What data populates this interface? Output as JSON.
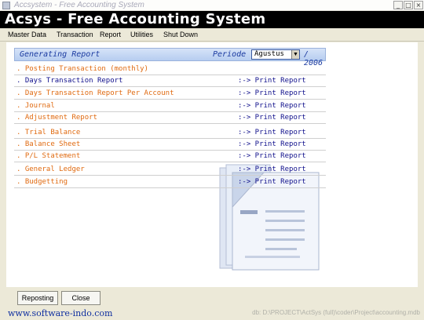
{
  "window": {
    "title": "Accsystem - Free Accounting System",
    "banner": "Acsys - Free Accounting System"
  },
  "menu": [
    "Master Data",
    "Transaction",
    "Report",
    "Utilities",
    "Shut Down"
  ],
  "report_header": {
    "title": "Generating Report",
    "periode_label": "Periode :",
    "month": "Agustus",
    "year": "/ 2006"
  },
  "reports": [
    {
      "label": ". Posting Transaction (monthly)",
      "action": ""
    },
    {
      "label": ". Days Transaction Report",
      "action": ":-> Print Report"
    },
    {
      "label": ". Days Transaction Report Per Account",
      "action": ":-> Print Report"
    },
    {
      "label": ". Journal",
      "action": ":-> Print Report"
    },
    {
      "label": ". Adjustment Report",
      "action": ":-> Print Report"
    },
    {
      "label": ". Trial Balance",
      "action": ":-> Print Report"
    },
    {
      "label": ". Balance Sheet",
      "action": ":-> Print Report"
    },
    {
      "label": ". P/L Statement",
      "action": ":-> Print Report"
    },
    {
      "label": ". General Ledger",
      "action": ":-> Print Report"
    },
    {
      "label": ". Budgetting",
      "action": ":-> Print Report"
    }
  ],
  "buttons": {
    "reposting": "Reposting",
    "close": "Close"
  },
  "status": {
    "url": "www.software-indo.com",
    "db_path": "db: D:\\PROJECT\\ActSys (full)\\coder\\Project\\accounting.mdb"
  },
  "colors": {
    "report_item": "#e06a10",
    "active_item": "#10108c",
    "header_gradient": "#b6cdf0"
  }
}
